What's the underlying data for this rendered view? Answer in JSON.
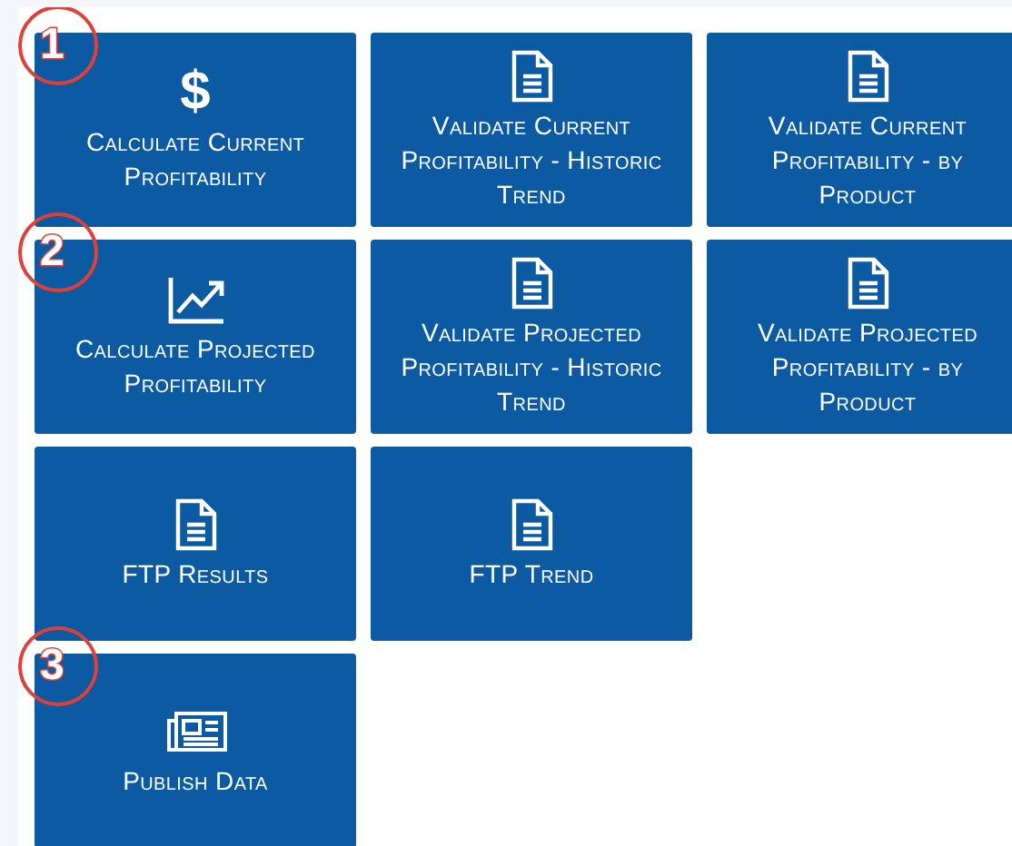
{
  "rows": [
    {
      "tiles": [
        {
          "label": "Calculate Current Profitability",
          "kind": "dollar",
          "icon_text": "$",
          "badge": "1"
        },
        {
          "label": "Validate Current Profitability - Historic Trend",
          "kind": "document"
        },
        {
          "label": "Validate Current Profitability - by Product",
          "kind": "document"
        }
      ]
    },
    {
      "tiles": [
        {
          "label": "Calculate Projected Profitability",
          "kind": "chart",
          "badge": "2"
        },
        {
          "label": "Validate Projected Profitability - Historic Trend",
          "kind": "document"
        },
        {
          "label": "Validate Projected Profitability - by Product",
          "kind": "document"
        }
      ]
    },
    {
      "tiles": [
        {
          "label": "FTP Results",
          "kind": "document"
        },
        {
          "label": "FTP Trend",
          "kind": "document"
        }
      ]
    },
    {
      "tiles": [
        {
          "label": "Publish Data",
          "kind": "newspaper",
          "badge": "3"
        }
      ]
    }
  ]
}
